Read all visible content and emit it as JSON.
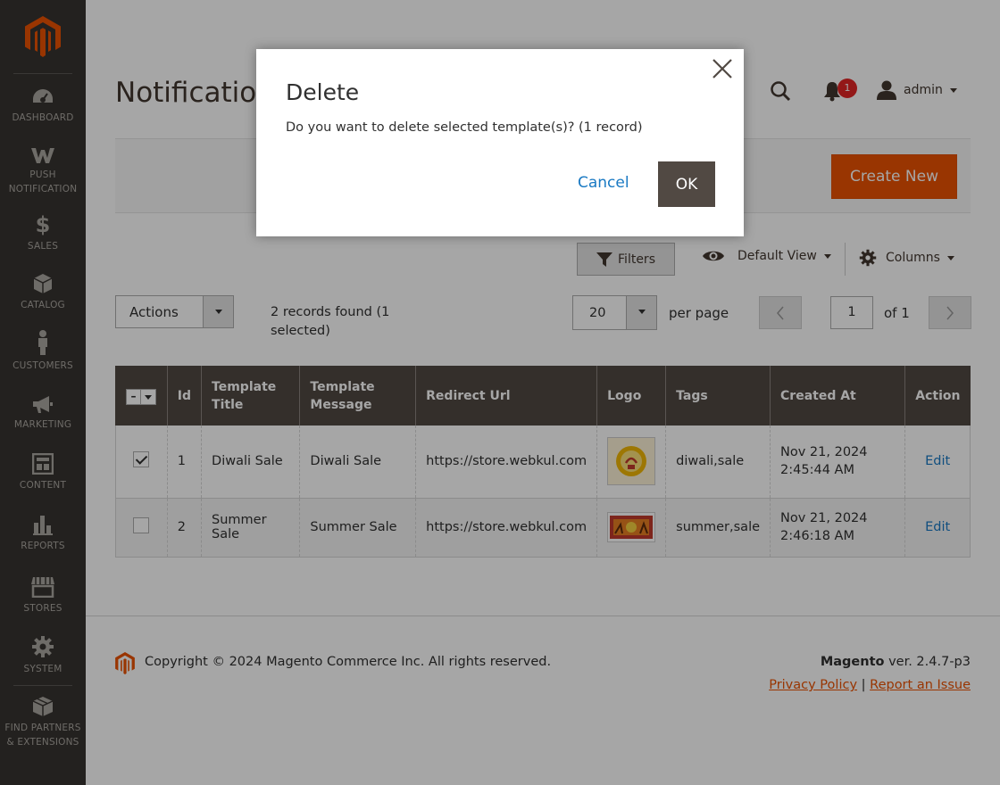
{
  "sidebar": {
    "items": [
      {
        "label": "DASHBOARD",
        "icon": "dashboard-icon"
      },
      {
        "label": "PUSH NOTIFICATION",
        "icon": "webkul-w-icon"
      },
      {
        "label": "SALES",
        "icon": "dollar-icon"
      },
      {
        "label": "CATALOG",
        "icon": "cube-icon"
      },
      {
        "label": "CUSTOMERS",
        "icon": "person-icon"
      },
      {
        "label": "MARKETING",
        "icon": "megaphone-icon"
      },
      {
        "label": "CONTENT",
        "icon": "content-icon"
      },
      {
        "label": "REPORTS",
        "icon": "bar-chart-icon"
      },
      {
        "label": "STORES",
        "icon": "storefront-icon"
      },
      {
        "label": "SYSTEM",
        "icon": "gear-icon"
      },
      {
        "label": "FIND PARTNERS & EXTENSIONS",
        "icon": "extensions-icon"
      }
    ]
  },
  "header": {
    "page_title": "Notifications",
    "notification_count": "1",
    "user_name": "admin"
  },
  "toolbar": {
    "create_new": "Create New",
    "filters": "Filters",
    "default_view": "Default View",
    "columns": "Columns",
    "actions": "Actions",
    "records_found": "2 records found (1 selected)",
    "per_page_value": "20",
    "per_page_label": "per page",
    "page_current": "1",
    "page_of": "of 1"
  },
  "grid": {
    "columns": [
      "Id",
      "Template Title",
      "Template Message",
      "Redirect Url",
      "Logo",
      "Tags",
      "Created At",
      "Action"
    ],
    "rows": [
      {
        "selected": true,
        "id": "1",
        "title": "Diwali Sale",
        "message": "Diwali Sale",
        "url": "https://store.webkul.com",
        "tags": "diwali,sale",
        "created": "Nov 21, 2024 2:45:44 AM",
        "action": "Edit"
      },
      {
        "selected": false,
        "id": "2",
        "title": "Summer Sale",
        "message": "Summer Sale",
        "url": "https://store.webkul.com",
        "tags": "summer,sale",
        "created": "Nov 21, 2024 2:46:18 AM",
        "action": "Edit"
      }
    ]
  },
  "footer": {
    "copyright": "Copyright © 2024 Magento Commerce Inc. All rights reserved.",
    "brand": "Magento",
    "version": "ver. 2.4.7-p3",
    "privacy": "Privacy Policy",
    "separator": "|",
    "report": "Report an Issue"
  },
  "modal": {
    "title": "Delete",
    "message": "Do you want to delete selected template(s)? (1 record)",
    "cancel": "Cancel",
    "ok": "OK"
  },
  "colors": {
    "sidebar_bg": "#373330",
    "accent": "#eb5202",
    "grid_header": "#514943",
    "link": "#1979c3"
  }
}
